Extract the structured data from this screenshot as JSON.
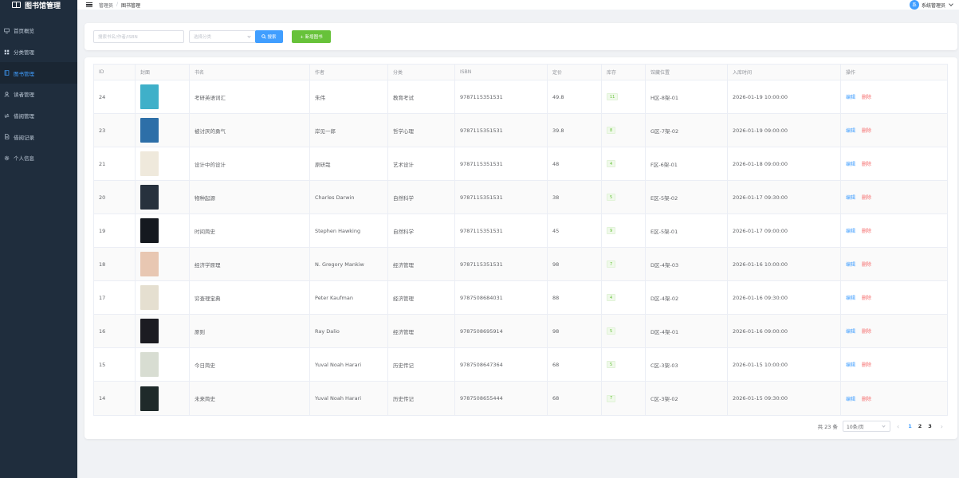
{
  "brand": {
    "title": "图书馆管理"
  },
  "sidebar": {
    "items": [
      {
        "label": "首页概览",
        "icon": "monitor-icon",
        "active": false
      },
      {
        "label": "分类管理",
        "icon": "grid-icon",
        "active": false
      },
      {
        "label": "图书管理",
        "icon": "book-icon",
        "active": true
      },
      {
        "label": "读者管理",
        "icon": "user-icon",
        "active": false
      },
      {
        "label": "借阅管理",
        "icon": "swap-icon",
        "active": false
      },
      {
        "label": "借阅记录",
        "icon": "document-icon",
        "active": false
      },
      {
        "label": "个人信息",
        "icon": "gear-icon",
        "active": false
      }
    ]
  },
  "header": {
    "breadcrumb": [
      "管理员",
      "图书管理"
    ],
    "user_name": "系统管理员",
    "avatar_text": "系"
  },
  "search": {
    "placeholder": "搜索书名/作者/ISBN",
    "category_placeholder": "选择分类",
    "search_label": "搜索",
    "add_label": "+ 新增图书"
  },
  "table": {
    "columns": [
      "ID",
      "封面",
      "书名",
      "作者",
      "分类",
      "ISBN",
      "定价",
      "库存",
      "馆藏位置",
      "入库时间",
      "操作"
    ],
    "rows": [
      {
        "id": "24",
        "title": "考研英语词汇",
        "author": "朱伟",
        "category": "教育考试",
        "isbn": "9787115351531",
        "price": "49.8",
        "stock": "11",
        "location": "H区-8架-01",
        "time": "2026-01-19 10:00:00",
        "cover_color": "#3fb0c9"
      },
      {
        "id": "23",
        "title": "被讨厌的勇气",
        "author": "岸见一郎",
        "category": "哲学心理",
        "isbn": "9787115351531",
        "price": "39.8",
        "stock": "8",
        "location": "G区-7架-02",
        "time": "2026-01-19 09:00:00",
        "cover_color": "#2d6fa8"
      },
      {
        "id": "21",
        "title": "设计中的设计",
        "author": "原研哉",
        "category": "艺术设计",
        "isbn": "9787115351531",
        "price": "48",
        "stock": "4",
        "location": "F区-6架-01",
        "time": "2026-01-18 09:00:00",
        "cover_color": "#efe9dc"
      },
      {
        "id": "20",
        "title": "物种起源",
        "author": "Charles Darwin",
        "category": "自然科学",
        "isbn": "9787115351531",
        "price": "38",
        "stock": "5",
        "location": "E区-5架-02",
        "time": "2026-01-17 09:30:00",
        "cover_color": "#27313d"
      },
      {
        "id": "19",
        "title": "时间简史",
        "author": "Stephen Hawking",
        "category": "自然科学",
        "isbn": "9787115351531",
        "price": "45",
        "stock": "9",
        "location": "E区-5架-01",
        "time": "2026-01-17 09:00:00",
        "cover_color": "#15191f"
      },
      {
        "id": "18",
        "title": "经济学原理",
        "author": "N. Gregory Mankiw",
        "category": "经济管理",
        "isbn": "9787115351531",
        "price": "98",
        "stock": "7",
        "location": "D区-4架-03",
        "time": "2026-01-16 10:00:00",
        "cover_color": "#e8c7b2"
      },
      {
        "id": "17",
        "title": "穷查理宝典",
        "author": "Peter Kaufman",
        "category": "经济管理",
        "isbn": "9787508684031",
        "price": "88",
        "stock": "4",
        "location": "D区-4架-02",
        "time": "2026-01-16 09:30:00",
        "cover_color": "#e5dfd0"
      },
      {
        "id": "16",
        "title": "原则",
        "author": "Ray Dalio",
        "category": "经济管理",
        "isbn": "9787508695914",
        "price": "98",
        "stock": "5",
        "location": "D区-4架-01",
        "time": "2026-01-16 09:00:00",
        "cover_color": "#1c1c22"
      },
      {
        "id": "15",
        "title": "今日简史",
        "author": "Yuval Noah Harari",
        "category": "历史传记",
        "isbn": "9787508647364",
        "price": "68",
        "stock": "5",
        "location": "C区-3架-03",
        "time": "2026-01-15 10:00:00",
        "cover_color": "#d8ddd2"
      },
      {
        "id": "14",
        "title": "未来简史",
        "author": "Yuval Noah Harari",
        "category": "历史传记",
        "isbn": "9787508655444",
        "price": "68",
        "stock": "7",
        "location": "C区-3架-02",
        "time": "2026-01-15 09:30:00",
        "cover_color": "#1f2a2a"
      }
    ],
    "edit_label": "编辑",
    "delete_label": "删除"
  },
  "pagination": {
    "total_text": "共 23 条",
    "page_size": "10条/页",
    "pages": [
      "1",
      "2",
      "3"
    ],
    "current_page": "1"
  }
}
